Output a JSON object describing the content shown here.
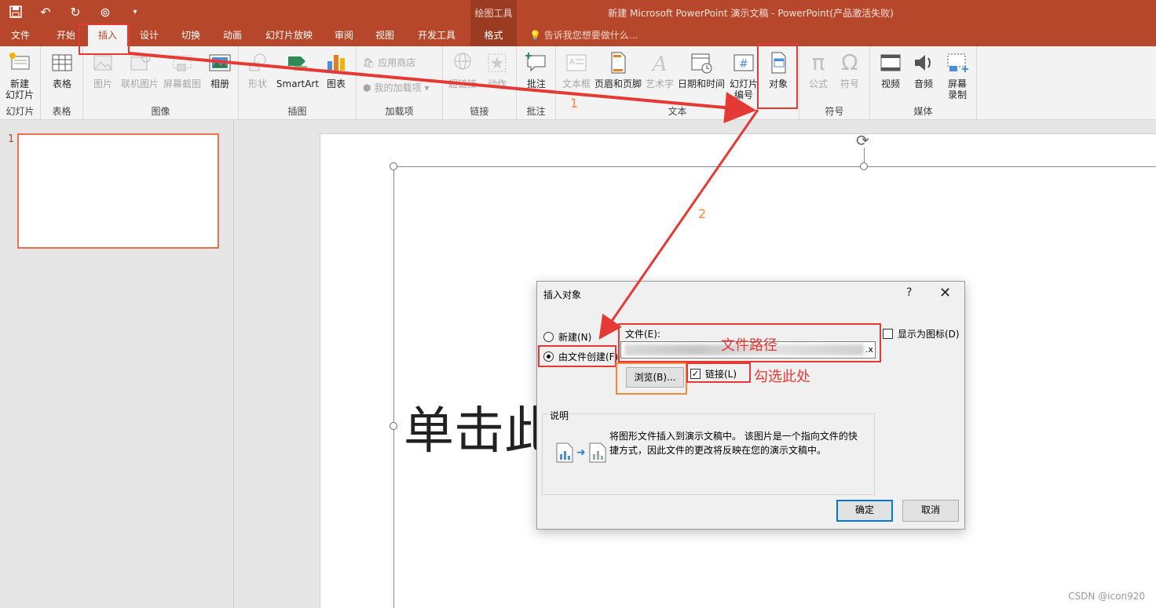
{
  "window": {
    "title": "新建 Microsoft PowerPoint 演示文稿 - PowerPoint(产品激活失败)",
    "context_tools_label": "绘图工具"
  },
  "tabs": [
    "文件",
    "开始",
    "插入",
    "设计",
    "切换",
    "动画",
    "幻灯片放映",
    "审阅",
    "视图",
    "开发工具",
    "格式"
  ],
  "tell_me": "告诉我您想要做什么...",
  "ribbon": {
    "groups": {
      "slides": "幻灯片",
      "tables": "表格",
      "images": "图像",
      "illustrations": "插图",
      "addins": "加载项",
      "links": "链接",
      "comments": "批注",
      "text": "文本",
      "symbols": "符号",
      "media": "媒体"
    },
    "buttons": {
      "new_slide": "新建\n幻灯片",
      "table": "表格",
      "picture": "图片",
      "online_picture": "联机图片",
      "screenshot": "屏幕截图",
      "album": "相册",
      "shapes": "形状",
      "smartart": "SmartArt",
      "chart": "图表",
      "store": "应用商店",
      "my_addins": "我的加载项",
      "hyperlink": "超链接",
      "action": "动作",
      "comment": "批注",
      "textbox": "文本框",
      "header_footer": "页眉和页脚",
      "wordart": "艺术字",
      "datetime": "日期和时间",
      "slide_number": "幻灯片\n编号",
      "object": "对象",
      "equation": "公式",
      "symbol": "符号",
      "video": "视频",
      "audio": "音频",
      "screen_recording": "屏幕\n录制"
    }
  },
  "slides_pane": {
    "slide_number": "1"
  },
  "slide": {
    "placeholder_text": "单击此处添加标题"
  },
  "dialog": {
    "title": "插入对象",
    "help": "?",
    "close": "✕",
    "option_new": "新建(N)",
    "option_from_file": "由文件创建(F)",
    "file_label": "文件(E):",
    "file_value_tail": ".x",
    "display_as_icon": "显示为图标(D)",
    "browse": "浏览(B)...",
    "link": "链接(L)",
    "desc_label": "说明",
    "desc_text": "将图形文件插入到演示文稿中。 该图片是一个指向文件的快捷方式，因此文件的更改将反映在您的演示文稿中。",
    "ok": "确定",
    "cancel": "取消"
  },
  "annotations": {
    "step1": "1",
    "step2": "2",
    "file_path": "文件路径",
    "check_here": "勾选此处"
  },
  "watermark": "CSDN @icon920",
  "colors": {
    "accent": "#b7472a",
    "annotation_red": "#e53935",
    "annotation_orange": "#f0883e"
  }
}
